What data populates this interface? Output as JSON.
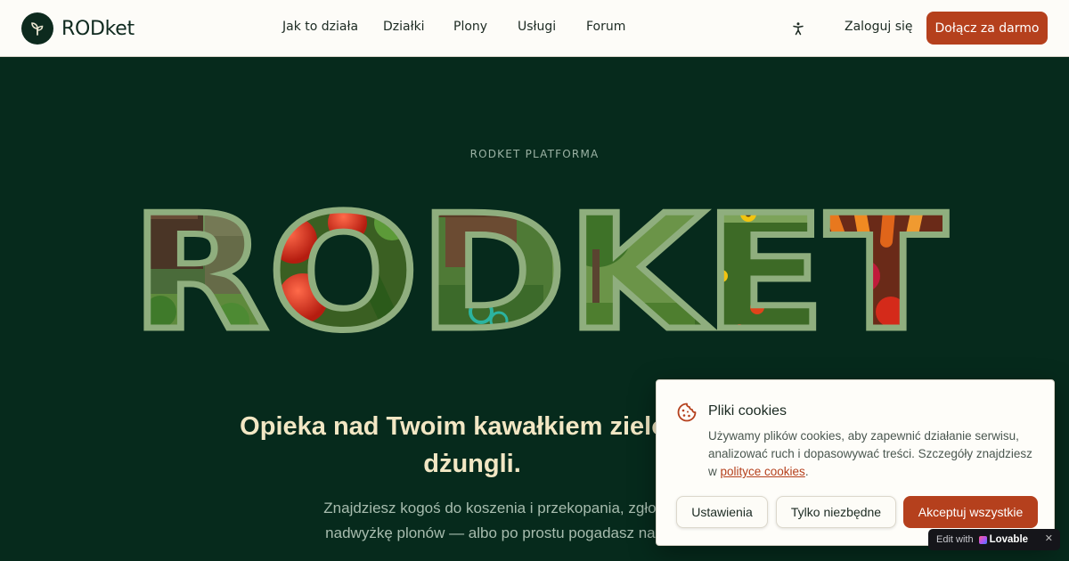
{
  "header": {
    "logo_text": "RODket",
    "nav": [
      "Jak to działa",
      "Działki",
      "Plony",
      "Usługi",
      "Forum"
    ],
    "login_label": "Zaloguj się",
    "join_label": "Dołącz za darmo"
  },
  "hero": {
    "eyebrow": "RODKET PLATFORMA",
    "big_word": "RODKET",
    "headline_line1": "Opieka nad Twoim kawałkiem zielonej",
    "headline_line2": "dżungli.",
    "subtext_line1": "Znajdziesz kogoś do koszenia i przekopania, zgłosisz czasową",
    "subtext_line2": "nadwyżkę plonów — albo po prostu pogadasz na forum o tym,"
  },
  "cookie": {
    "title": "Pliki cookies",
    "text_before": "Używamy plików cookies, aby zapewnić działanie serwisu, analizować ruch i dopasowywać treści. Szczegóły znajdziesz w ",
    "link_text": "polityce cookies",
    "text_after": ".",
    "settings_label": "Ustawienia",
    "necessary_label": "Tylko niezbędne",
    "accept_label": "Akceptuj wszystkie"
  },
  "badge": {
    "edit_label": "Edit with",
    "brand": "Lovable",
    "close": "✕"
  },
  "colors": {
    "accent": "#b5401d",
    "hero_bg": "#062a1c",
    "header_bg": "#fdfcf8",
    "outline": "#8fae7e"
  },
  "icons": [
    "sprout-icon",
    "accessibility-icon",
    "cookie-icon",
    "lovable-heart-icon",
    "close-icon"
  ]
}
